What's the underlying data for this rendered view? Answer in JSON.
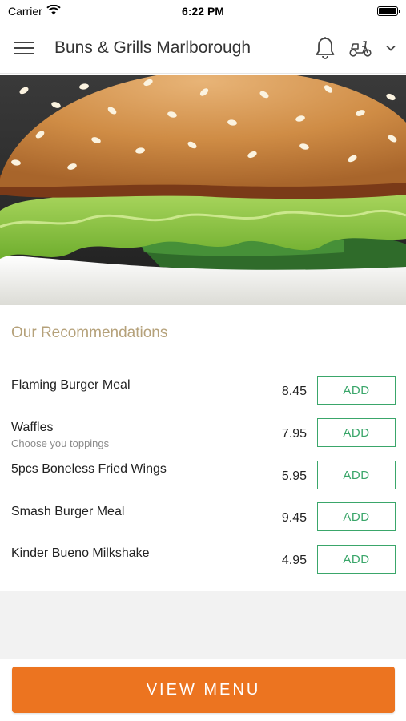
{
  "status_bar": {
    "carrier": "Carrier",
    "time": "6:22 PM"
  },
  "nav": {
    "title": "Buns & Grills Marlborough"
  },
  "recommendations": {
    "title": "Our Recommendations",
    "add_label": "ADD",
    "items": [
      {
        "name": "Flaming Burger Meal",
        "subtitle": "",
        "price": "8.45"
      },
      {
        "name": "Waffles",
        "subtitle": "Choose you toppings",
        "price": "7.95"
      },
      {
        "name": "5pcs Boneless Fried Wings",
        "subtitle": "",
        "price": "5.95"
      },
      {
        "name": "Smash Burger Meal",
        "subtitle": "",
        "price": "9.45"
      },
      {
        "name": "Kinder Bueno Milkshake",
        "subtitle": "",
        "price": "4.95"
      }
    ]
  },
  "footer": {
    "view_menu_label": "VIEW MENU"
  },
  "colors": {
    "accent": "#ec7420",
    "add_green": "#3aa66a",
    "heading_tan": "#b5a17a"
  },
  "icons": {
    "menu": "hamburger-menu-icon",
    "bell": "notification-bell-icon",
    "delivery": "delivery-scooter-icon",
    "chevron": "chevron-down-icon",
    "wifi": "wifi-icon",
    "battery": "battery-icon"
  }
}
